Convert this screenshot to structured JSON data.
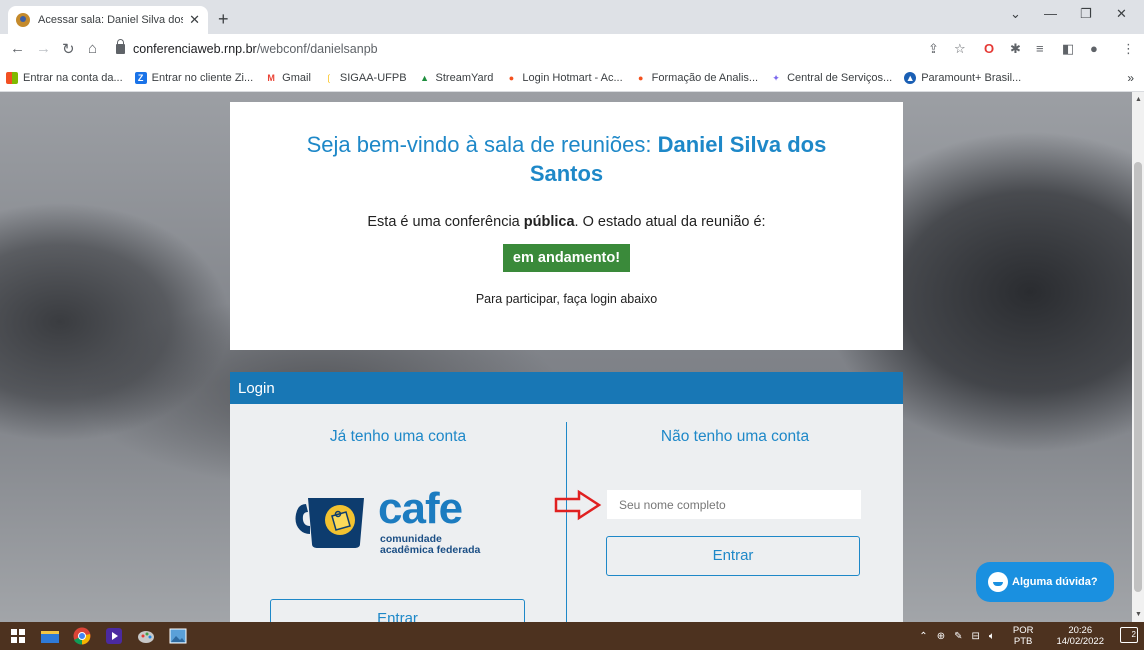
{
  "browser": {
    "tab_title": "Acessar sala: Daniel Silva dos Sar",
    "url_host": "conferenciaweb.rnp.br",
    "url_path": "/webconf/danielsanpb",
    "bookmarks": [
      {
        "label": "Entrar na conta da...",
        "color": "#34a853",
        "icon": "microsoft-icon"
      },
      {
        "label": "Entrar no cliente Zi...",
        "color": "#1a73e8",
        "icon": "zoho-icon"
      },
      {
        "label": "Gmail",
        "color": "#ea4335",
        "icon": "gmail-icon"
      },
      {
        "label": "SIGAA-UFPB",
        "color": "#fbbc04",
        "icon": "sigaa-icon"
      },
      {
        "label": "StreamYard",
        "color": "#1e8e3e",
        "icon": "streamyard-icon"
      },
      {
        "label": "Login Hotmart - Ac...",
        "color": "#f4511e",
        "icon": "hotmart-icon"
      },
      {
        "label": "Formação de Analis...",
        "color": "#f4511e",
        "icon": "hotmart-icon"
      },
      {
        "label": "Central de Serviços...",
        "color": "#7b68ee",
        "icon": "services-icon"
      },
      {
        "label": "Paramount+ Brasil...",
        "color": "#1a5fb4",
        "icon": "paramount-icon"
      }
    ],
    "bookmarks_more": "»"
  },
  "welcome": {
    "title_prefix": "Seja bem-vindo à sala de reuniões: ",
    "room_name": "Daniel Silva dos Santos",
    "conf_prefix": "Esta é uma conferência ",
    "conf_type": "pública",
    "conf_suffix": ". O estado atual da reunião é:",
    "status": "em andamento!",
    "hint": "Para participar, faça login abaixo"
  },
  "login": {
    "header": "Login",
    "left_title": "Já tenho uma conta",
    "right_title": "Não tenho uma conta",
    "cafe_word": "cafe",
    "cafe_sub_1": "comunidade",
    "cafe_sub_2": "acadêmica federada",
    "name_placeholder": "Seu nome completo",
    "enter_label": "Entrar",
    "enter_label_left": "Entrar"
  },
  "help": {
    "label": "Alguma dúvida?"
  },
  "taskbar": {
    "lang_top": "POR",
    "lang_bottom": "PTB",
    "time": "20:26",
    "date": "14/02/2022",
    "notif_count": "2"
  }
}
